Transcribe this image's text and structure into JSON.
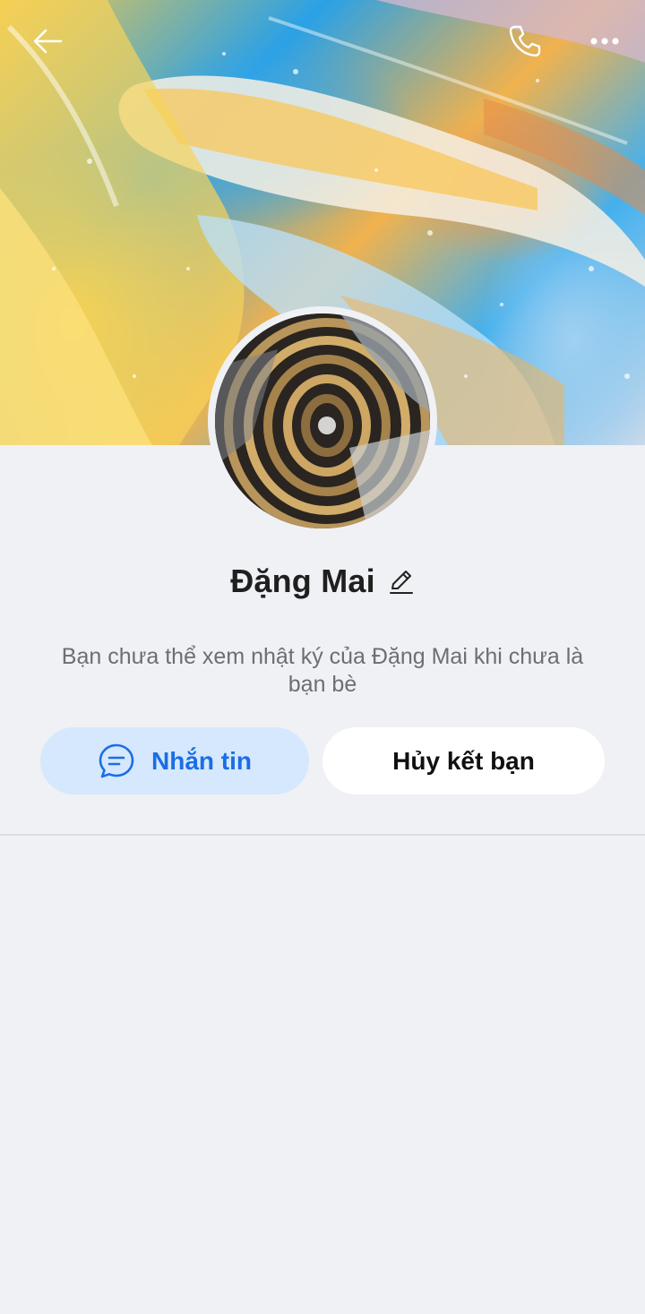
{
  "profile": {
    "name": "Đặng Mai",
    "diary_notice": "Bạn chưa thể xem nhật ký của Đặng Mai khi chưa là bạn bè"
  },
  "actions": {
    "message_label": "Nhắn tin",
    "unfriend_label": "Hủy kết bạn"
  },
  "icons": {
    "back": "arrow-left-icon",
    "call": "phone-icon",
    "more": "more-dots-icon",
    "edit": "pencil-icon",
    "message": "chat-bubble-icon"
  },
  "colors": {
    "accent": "#1a6ee6",
    "accent_bg": "#d6e8fd",
    "background": "#f0f1f5"
  }
}
